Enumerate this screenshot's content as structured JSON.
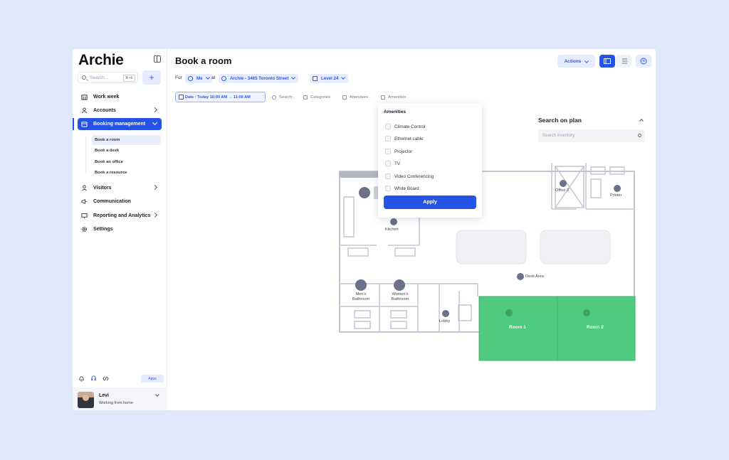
{
  "app": {
    "name": "Archie"
  },
  "sidebar": {
    "search_placeholder": "Search...",
    "search_shortcut": "⌘+K",
    "add_button": "+",
    "items": [
      {
        "label": "Work week",
        "icon": "building-icon",
        "has_chevron": false
      },
      {
        "label": "Accounts",
        "icon": "accounts-icon",
        "has_chevron": true
      },
      {
        "label": "Booking management",
        "icon": "calendar-icon",
        "has_chevron": true,
        "active": true
      },
      {
        "label": "Visitors",
        "icon": "visitor-icon",
        "has_chevron": true
      },
      {
        "label": "Communication",
        "icon": "megaphone-icon",
        "has_chevron": false
      },
      {
        "label": "Reporting and Analytics",
        "icon": "monitor-icon",
        "has_chevron": true
      },
      {
        "label": "Settings",
        "icon": "gear-icon",
        "has_chevron": false
      }
    ],
    "sub_items": [
      "Book a room",
      "Book a desk",
      "Book an office",
      "Book a resource"
    ],
    "apps_label": "Apps",
    "user": {
      "name": "Levi",
      "status": "Working from home"
    }
  },
  "header": {
    "title": "Book a room",
    "actions_label": "Actions",
    "for_label": "For",
    "for_value": "Me",
    "at_label": "at",
    "location": "Archie - 3465 Toronto Street",
    "level": "Level 24"
  },
  "filters": {
    "date": "Date : Today 10:00 AM → 11:00 AM",
    "search": "Search",
    "categories": "Categories",
    "attendees": "Attendees",
    "amenities": "Amenities"
  },
  "amenities_dropdown": {
    "title": "Amenities",
    "options": [
      "Climate Control",
      "Ethernet cable",
      "Projector",
      "TV",
      "Video Conferencing",
      "White Board"
    ],
    "apply_label": "Apply"
  },
  "search_on_plan": {
    "title": "Search on plan",
    "placeholder": "Search inventory"
  },
  "floor_plan": {
    "labels": {
      "kitchen": "Kitchen",
      "mens": "Men's\nBathroom",
      "womens": "Women's\nBathroom",
      "lobby": "Lobby",
      "office2": "Office 2",
      "printer": "Printer",
      "desk_area": "Desk Area",
      "room1": "Room 1",
      "room2": "Room 2"
    },
    "room_color": "#4fc97d"
  },
  "colors": {
    "accent": "#2553e8",
    "background": "#dfe7fb"
  }
}
